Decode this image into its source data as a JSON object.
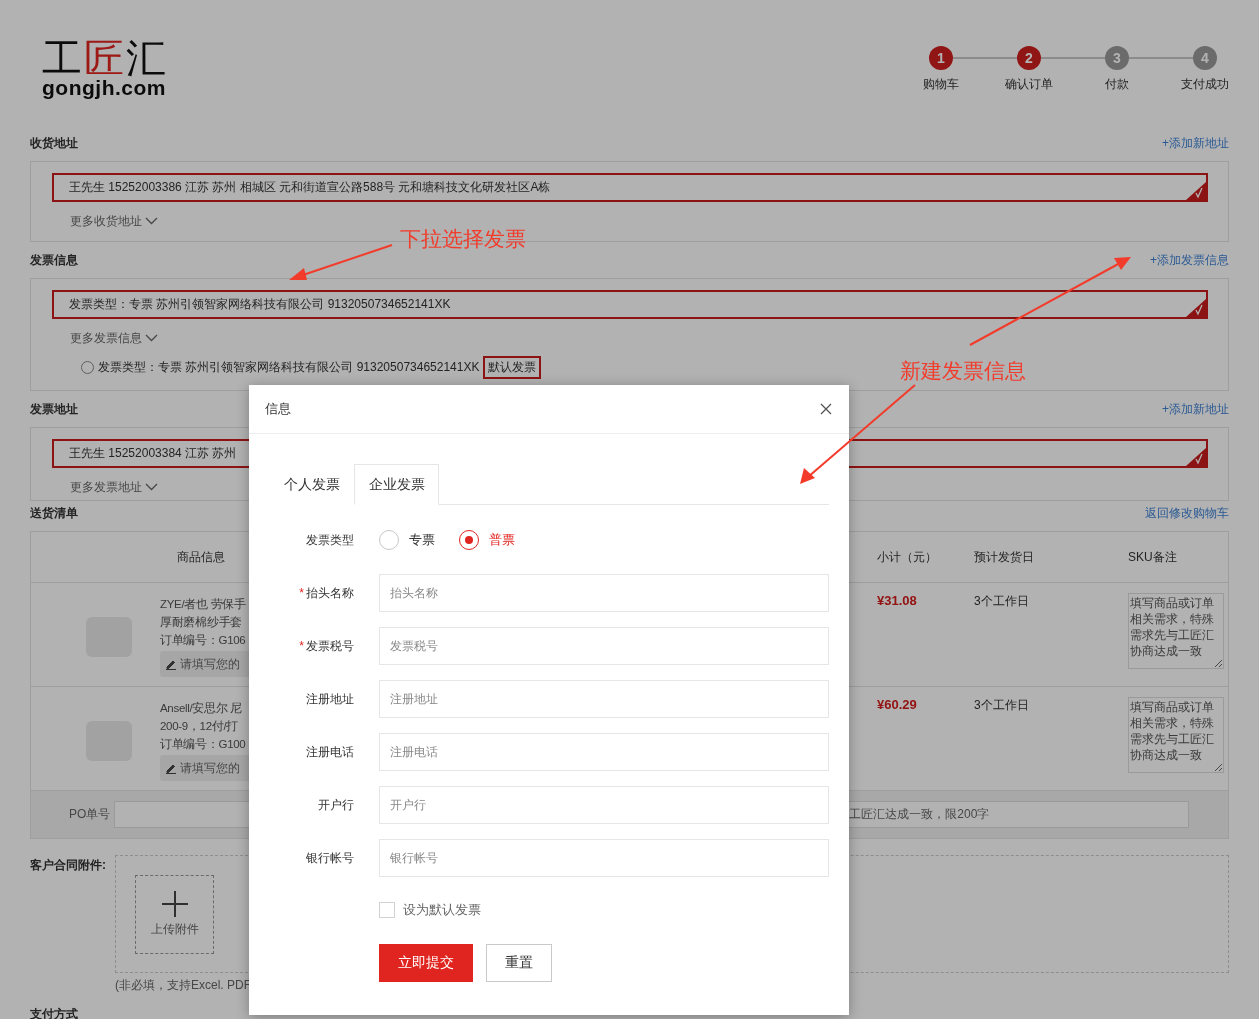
{
  "logo": {
    "before": "工",
    "accent": "匠",
    "after": "汇",
    "domain": "gongjh.com"
  },
  "steps": [
    {
      "number": "1",
      "label": "购物车",
      "done": true
    },
    {
      "number": "2",
      "label": "确认订单",
      "done": true
    },
    {
      "number": "3",
      "label": "付款",
      "done": false
    },
    {
      "number": "4",
      "label": "支付成功",
      "done": false
    }
  ],
  "sections": [
    {
      "kind": "shipping",
      "title": "收货地址",
      "link": "+添加新地址",
      "entry": {
        "text": "王先生  15252003386 江苏 苏州 相城区 元和街道宣公路588号 元和塘科技文化研发社区A栋",
        "selected": true
      },
      "more": "更多收货地址"
    },
    {
      "kind": "invoice",
      "title": "发票信息",
      "link": "+添加发票信息",
      "entry": {
        "text": "发票类型：专票 苏州引领智家网络科技有限公司 9132050734652141XK",
        "selected": true
      },
      "more": "更多发票信息",
      "option": {
        "text": "发票类型：专票 苏州引领智家网络科技有限公司 9132050734652141XK",
        "badge": "默认发票",
        "selected": false
      }
    },
    {
      "kind": "invoice_address",
      "title": "发票地址",
      "link": "+添加新地址",
      "entry": {
        "text": "王先生  15252003384 江苏 苏州",
        "selected": true
      },
      "more": "更多发票地址"
    }
  ],
  "delivery": {
    "title": "送货清单",
    "link": "返回修改购物车",
    "columns": [
      "商品信息",
      "小计（元）",
      "预计发货日",
      "SKU备注"
    ],
    "rows": [
      {
        "name_lines": [
          "ZYE/者也 劳保手",
          "厚耐磨棉纱手套"
        ],
        "order_no": "订单编号：G106",
        "note": "请填写您的",
        "subtotal": "¥31.08",
        "ship": "3个工作日",
        "sku_placeholder": "填写商品或订单相关需求，特殊需求先与工匠汇协商达成一致"
      },
      {
        "name_lines": [
          "Ansell/安思尔 尼",
          "200-9，12付/打"
        ],
        "order_no": "订单编号：G100",
        "note": "请填写您的",
        "subtotal": "¥60.29",
        "ship": "3个工作日",
        "sku_placeholder": "填写商品或订单相关需求，特殊需求先与工匠汇协商达成一致"
      }
    ],
    "po": {
      "label": "PO单号",
      "placeholder": "工匠汇达成一致，限200字"
    }
  },
  "attachment": {
    "label": "客户合同附件:",
    "upload": "上传附件",
    "hint": "(非必填，支持Excel. PDF"
  },
  "payment_title": "支付方式",
  "annotations": [
    {
      "text": "下拉选择发票"
    },
    {
      "text": "新建发票信息"
    }
  ],
  "dialog": {
    "title": "信息",
    "tabs": [
      {
        "label": "个人发票",
        "selected": false
      },
      {
        "label": "企业发票",
        "selected": true
      }
    ],
    "fields": [
      {
        "kind": "radio",
        "label": "发票类型",
        "options": [
          {
            "label": "专票",
            "selected": false
          },
          {
            "label": "普票",
            "selected": true
          }
        ]
      },
      {
        "kind": "text",
        "label": "抬头名称",
        "required_mark": "*",
        "placeholder": "抬头名称"
      },
      {
        "kind": "text",
        "label": "发票税号",
        "required_mark": "*",
        "placeholder": "发票税号"
      },
      {
        "kind": "text",
        "label": "注册地址",
        "placeholder": "注册地址"
      },
      {
        "kind": "text",
        "label": "注册电话",
        "placeholder": "注册电话"
      },
      {
        "kind": "text",
        "label": "开户行",
        "placeholder": "开户行"
      },
      {
        "kind": "text",
        "label": "银行帐号",
        "placeholder": "银行帐号"
      }
    ],
    "default_checkbox": {
      "label": "设为默认发票",
      "checked": false
    },
    "buttons": [
      {
        "kind": "primary",
        "label": "立即提交"
      },
      {
        "kind": "secondary",
        "label": "重置"
      }
    ]
  }
}
